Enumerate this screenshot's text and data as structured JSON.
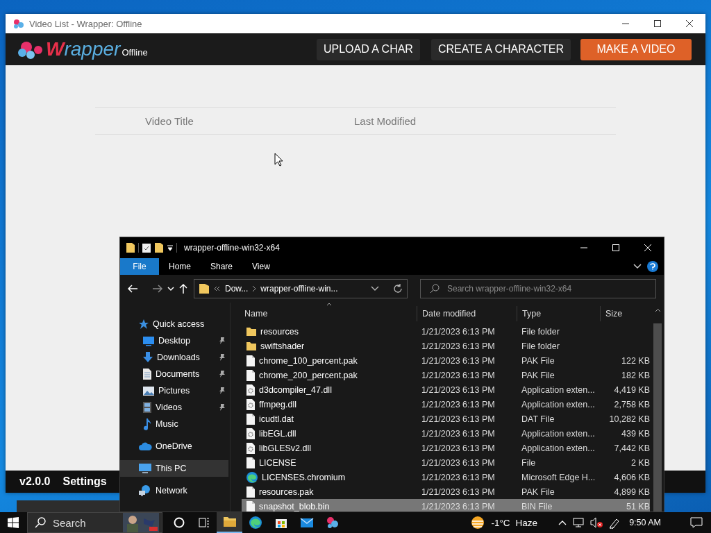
{
  "wrapper_window": {
    "title": "Video List - Wrapper: Offline",
    "logo": {
      "initial": "W",
      "rest": "rapper",
      "suffix": "Offline"
    },
    "nav_buttons": [
      {
        "label": "UPLOAD A CHAR",
        "kind": "dark"
      },
      {
        "label": "CREATE A CHARACTER",
        "kind": "dark"
      },
      {
        "label": "MAKE A VIDEO",
        "kind": "primary"
      }
    ],
    "table": {
      "columns": [
        "Video Title",
        "Last Modified"
      ]
    },
    "footer": [
      "v2.0.0",
      "Settings"
    ]
  },
  "explorer": {
    "title": "wrapper-offline-win32-x64",
    "ribbon_tabs": [
      {
        "label": "File",
        "kind": "file"
      },
      {
        "label": "Home",
        "kind": "tab"
      },
      {
        "label": "Share",
        "kind": "tab"
      },
      {
        "label": "View",
        "kind": "tab"
      }
    ],
    "breadcrumb": [
      "Dow...",
      "wrapper-offline-win..."
    ],
    "search": {
      "placeholder": "Search wrapper-offline-win32-x64"
    },
    "nav": [
      {
        "label": "Quick access",
        "kind": "star",
        "selected": false,
        "children": [
          {
            "label": "Desktop",
            "kind": "desktop",
            "pinned": true,
            "selected": false
          },
          {
            "label": "Downloads",
            "kind": "download",
            "pinned": true,
            "selected": false
          },
          {
            "label": "Documents",
            "kind": "document",
            "pinned": true,
            "selected": false
          },
          {
            "label": "Pictures",
            "kind": "pictures",
            "pinned": true,
            "selected": false
          },
          {
            "label": "Videos",
            "kind": "videos",
            "pinned": true,
            "selected": false
          },
          {
            "label": "Music",
            "kind": "music",
            "pinned": false,
            "selected": false
          }
        ]
      },
      {
        "label": "OneDrive",
        "kind": "cloud",
        "selected": false
      },
      {
        "label": "This PC",
        "kind": "pc",
        "selected": true
      },
      {
        "label": "Network",
        "kind": "network",
        "selected": false
      }
    ],
    "columns": [
      "Name",
      "Date modified",
      "Type",
      "Size"
    ],
    "files": [
      {
        "name": "resources",
        "kind": "folder",
        "date": "1/21/2023 6:13 PM",
        "type": "File folder",
        "selected": false
      },
      {
        "name": "swiftshader",
        "kind": "folder",
        "date": "1/21/2023 6:13 PM",
        "type": "File folder",
        "selected": false
      },
      {
        "name": "chrome_100_percent.pak",
        "kind": "file",
        "date": "1/21/2023 6:13 PM",
        "type": "PAK File",
        "size": "122 KB",
        "selected": false
      },
      {
        "name": "chrome_200_percent.pak",
        "kind": "file",
        "date": "1/21/2023 6:13 PM",
        "type": "PAK File",
        "size": "182 KB",
        "selected": false
      },
      {
        "name": "d3dcompiler_47.dll",
        "kind": "dll",
        "date": "1/21/2023 6:13 PM",
        "type": "Application exten...",
        "size": "4,419 KB",
        "selected": false
      },
      {
        "name": "ffmpeg.dll",
        "kind": "dll",
        "date": "1/21/2023 6:13 PM",
        "type": "Application exten...",
        "size": "2,758 KB",
        "selected": false
      },
      {
        "name": "icudtl.dat",
        "kind": "file",
        "date": "1/21/2023 6:13 PM",
        "type": "DAT File",
        "size": "10,282 KB",
        "selected": false
      },
      {
        "name": "libEGL.dll",
        "kind": "dll",
        "date": "1/21/2023 6:13 PM",
        "type": "Application exten...",
        "size": "439 KB",
        "selected": false
      },
      {
        "name": "libGLESv2.dll",
        "kind": "dll",
        "date": "1/21/2023 6:13 PM",
        "type": "Application exten...",
        "size": "7,442 KB",
        "selected": false
      },
      {
        "name": "LICENSE",
        "kind": "file",
        "date": "1/21/2023 6:13 PM",
        "type": "File",
        "size": "2 KB",
        "selected": false
      },
      {
        "name": "LICENSES.chromium",
        "kind": "edge",
        "date": "1/21/2023 6:13 PM",
        "type": "Microsoft Edge H...",
        "size": "4,606 KB",
        "selected": false
      },
      {
        "name": "resources.pak",
        "kind": "file",
        "date": "1/21/2023 6:13 PM",
        "type": "PAK File",
        "size": "4,899 KB",
        "selected": false
      },
      {
        "name": "snapshot_blob.bin",
        "kind": "file",
        "date": "1/21/2023 6:13 PM",
        "type": "BIN File",
        "size": "51 KB",
        "selected": true
      }
    ]
  },
  "taskbar": {
    "search": {
      "placeholder": "Search"
    },
    "apps": [
      {
        "kind": "explorer",
        "active": true
      },
      {
        "kind": "edge",
        "active": false
      },
      {
        "kind": "store",
        "active": false
      },
      {
        "kind": "mail",
        "active": false
      },
      {
        "kind": "wrapper",
        "active": false
      }
    ],
    "temperature": "-1°C",
    "weather": "Haze",
    "time": "9:50 AM"
  }
}
